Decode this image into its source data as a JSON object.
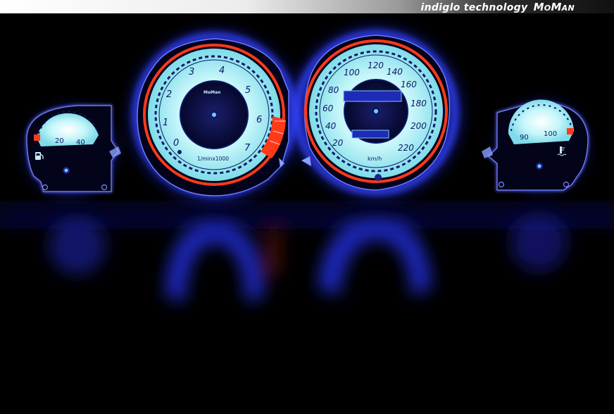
{
  "banner": {
    "text": "indiglo technology",
    "brand": "MoMan"
  },
  "tachometer": {
    "brand": "MoMan",
    "unit": "1/minx1000",
    "labels": [
      "0",
      "1",
      "2",
      "3",
      "4",
      "5",
      "6",
      "7"
    ]
  },
  "speedometer": {
    "unit": "km/h",
    "labels": [
      "20",
      "40",
      "60",
      "80",
      "100",
      "120",
      "140",
      "160",
      "180",
      "200",
      "220"
    ]
  },
  "fuel_gauge": {
    "labels": [
      "20",
      "40"
    ],
    "icon": "fuel-pump-icon"
  },
  "temp_gauge": {
    "labels": [
      "90",
      "100"
    ],
    "icon": "coolant-temperature-icon"
  },
  "colors": {
    "dial_face": "#aef0f5",
    "glow": "#2b3cff",
    "redline": "#ff3a1a",
    "markings": "#0b1a66"
  }
}
